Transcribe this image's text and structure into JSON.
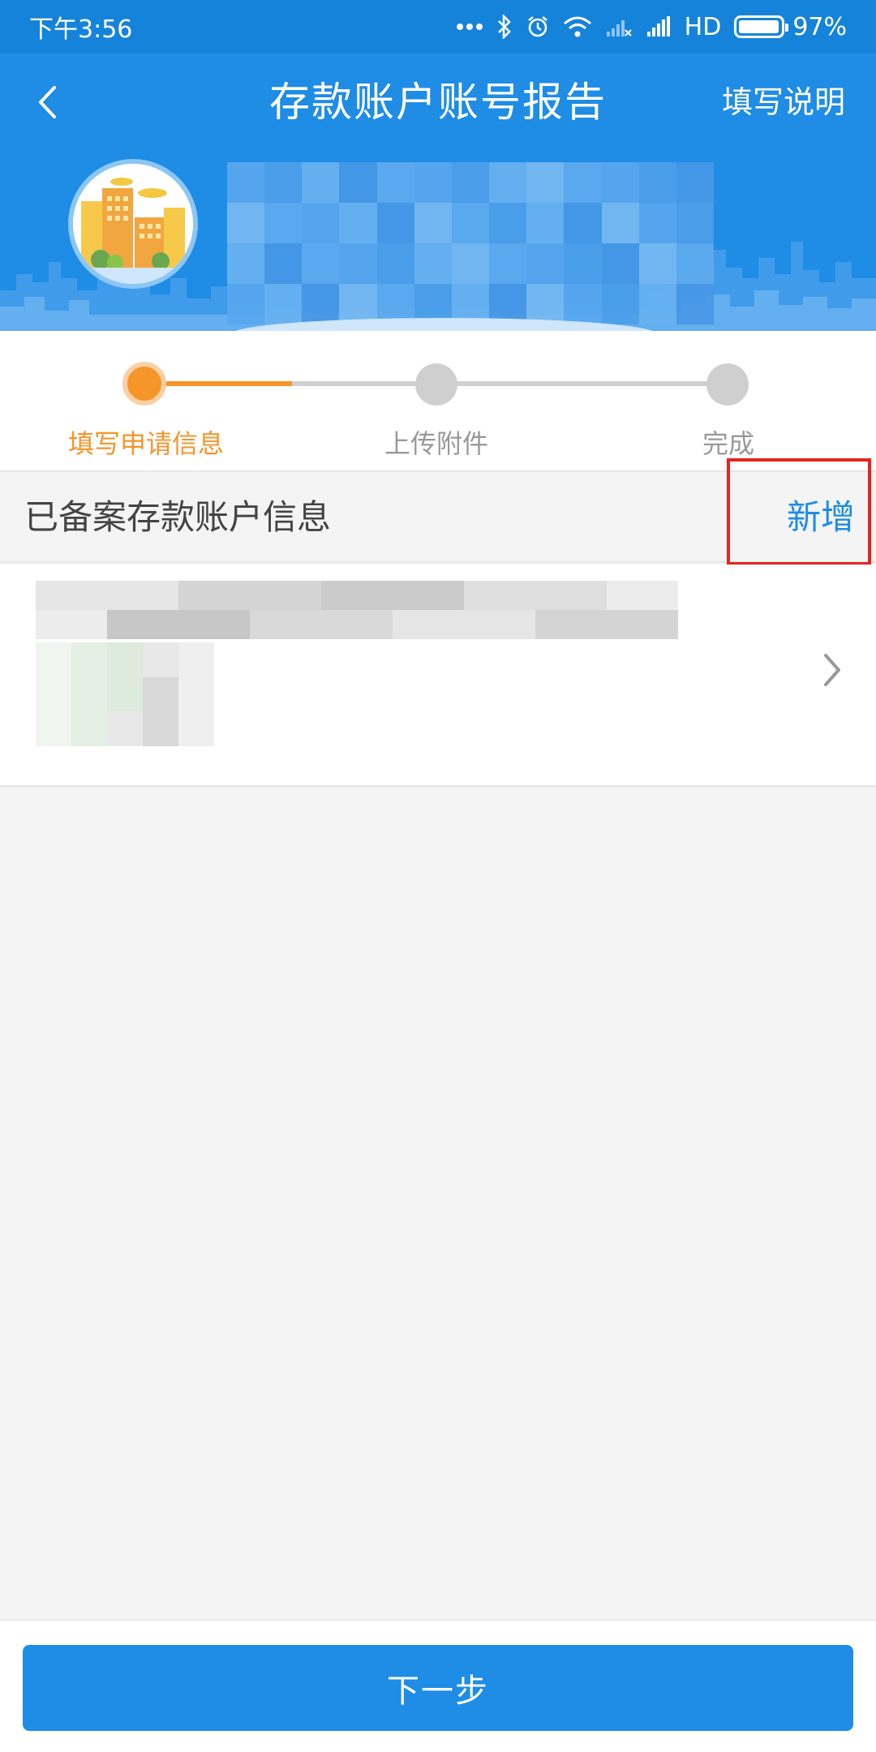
{
  "status_bar": {
    "time": "下午3:56",
    "network_type": "HD",
    "battery_percent": "97%",
    "battery_level": 0.97,
    "icons": [
      "more-dots-icon",
      "bluetooth-icon",
      "alarm-icon",
      "wifi-icon",
      "signal-off-icon",
      "signal-icon",
      "battery-icon"
    ]
  },
  "nav": {
    "title": "存款账户账号报告",
    "help_label": "填写说明",
    "back_icon": "chevron-left-icon"
  },
  "steps": {
    "items": [
      {
        "label": "填写申请信息",
        "state": "active"
      },
      {
        "label": "上传附件",
        "state": "pending"
      },
      {
        "label": "完成",
        "state": "pending"
      }
    ],
    "active_color": "#f6952a",
    "pending_color": "#cfcfcf"
  },
  "section": {
    "title": "已备案存款账户信息",
    "add_label": "新增"
  },
  "next_button": {
    "label": "下一步"
  },
  "colors": {
    "primary": "#1f8ce6",
    "status_bar": "#1683db",
    "accent": "#f6952a",
    "highlight": "#e8231f",
    "background": "#f4f4f4"
  }
}
